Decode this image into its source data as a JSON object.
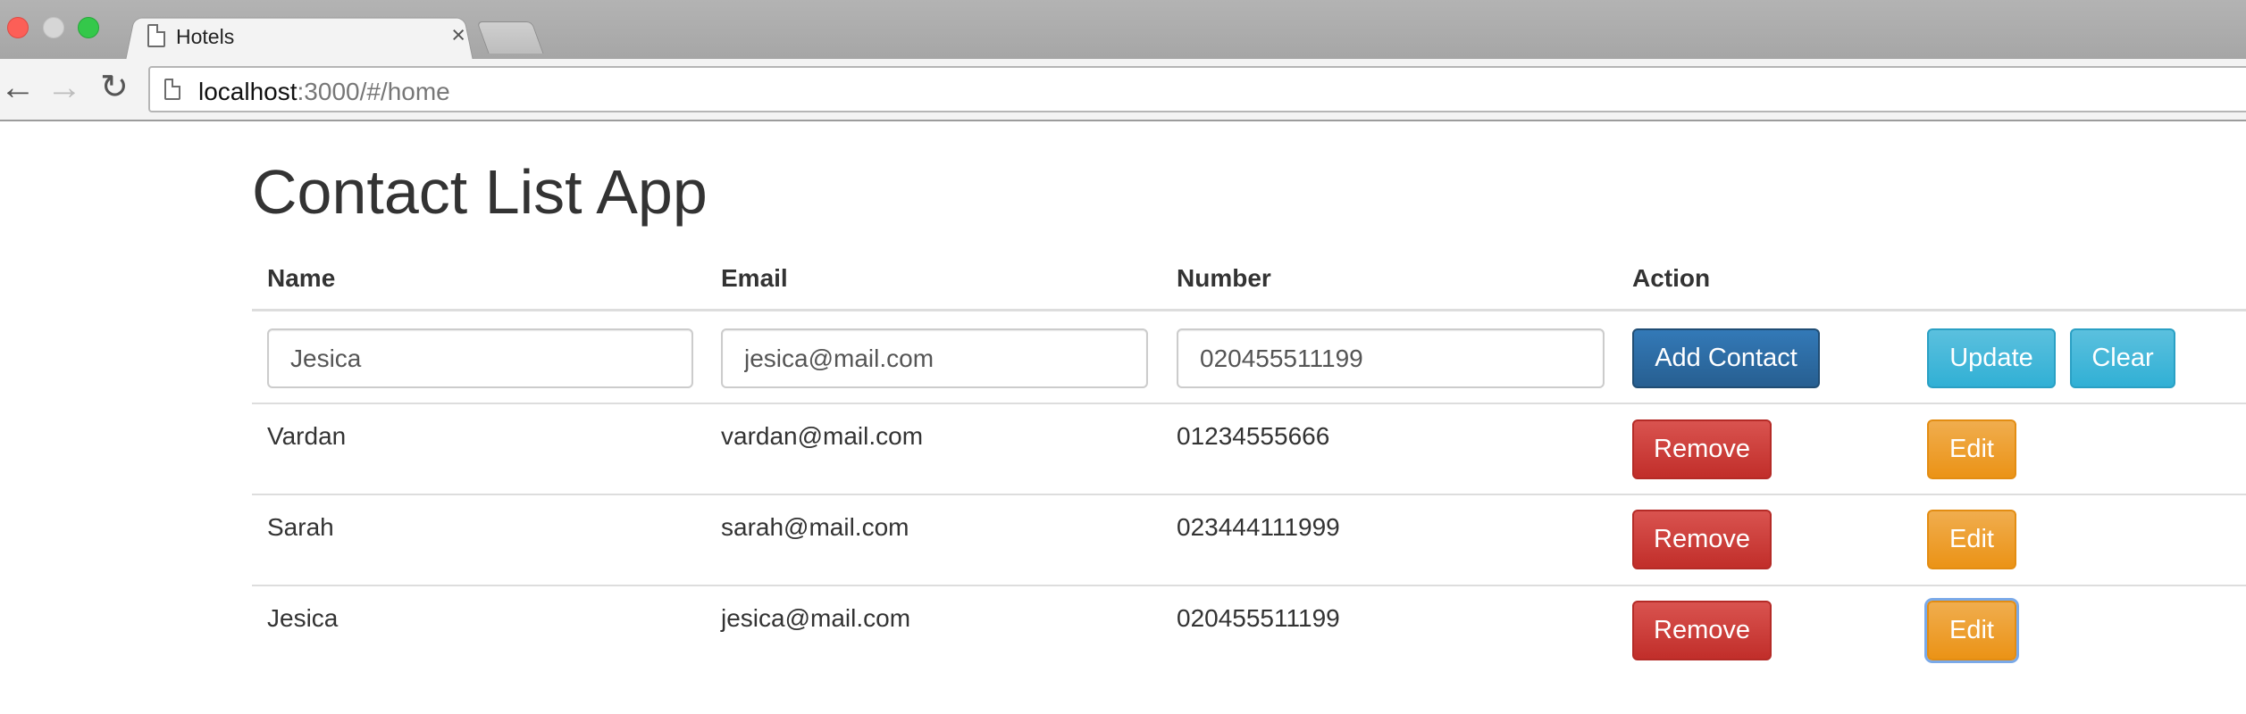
{
  "browser": {
    "tab_title": "Hotels",
    "tab_close": "×",
    "url_host": "localhost",
    "url_rest": ":3000/#/home"
  },
  "page": {
    "title": "Contact List App"
  },
  "table": {
    "headers": {
      "name": "Name",
      "email": "Email",
      "number": "Number",
      "action": "Action"
    },
    "form": {
      "name_value": "Jesica",
      "email_value": "jesica@mail.com",
      "number_value": "020455511199",
      "add_label": "Add Contact",
      "update_label": "Update",
      "clear_label": "Clear"
    },
    "rows": [
      {
        "name": "Vardan",
        "email": "vardan@mail.com",
        "number": "01234555666",
        "remove_label": "Remove",
        "edit_label": "Edit"
      },
      {
        "name": "Sarah",
        "email": "sarah@mail.com",
        "number": "023444111999",
        "remove_label": "Remove",
        "edit_label": "Edit"
      },
      {
        "name": "Jesica",
        "email": "jesica@mail.com",
        "number": "020455511199",
        "remove_label": "Remove",
        "edit_label": "Edit"
      }
    ]
  },
  "colors": {
    "primary": "#337ab7",
    "info": "#5bc0de",
    "danger": "#d9534f",
    "warning": "#f0ad4e"
  }
}
